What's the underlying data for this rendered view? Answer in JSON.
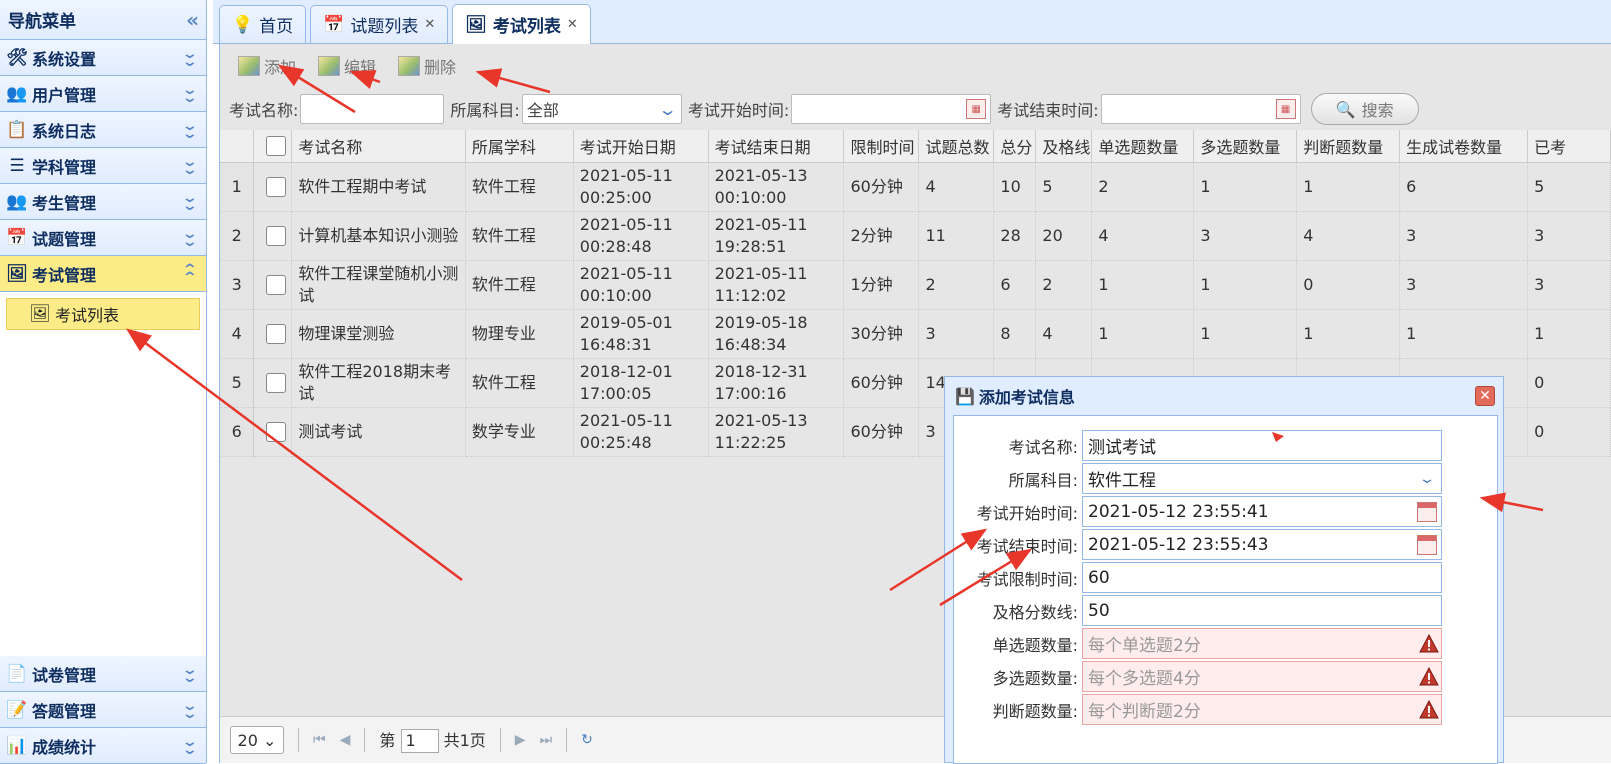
{
  "sidebar": {
    "title": "导航菜单",
    "groups_top": [
      {
        "label": "系统设置"
      },
      {
        "label": "用户管理"
      },
      {
        "label": "系统日志"
      },
      {
        "label": "学科管理"
      },
      {
        "label": "考生管理"
      },
      {
        "label": "试题管理"
      },
      {
        "label": "考试管理"
      }
    ],
    "active_sub": "考试列表",
    "groups_bottom": [
      {
        "label": "试卷管理"
      },
      {
        "label": "答题管理"
      },
      {
        "label": "成绩统计"
      }
    ]
  },
  "tabs": [
    {
      "label": "首页"
    },
    {
      "label": "试题列表"
    },
    {
      "label": "考试列表"
    }
  ],
  "toolbar": {
    "add": "添加",
    "edit": "编辑",
    "delete": "删除"
  },
  "filters": {
    "name_label": "考试名称:",
    "subject_label": "所属科目:",
    "subject_value": "全部",
    "start_label": "考试开始时间:",
    "end_label": "考试结束时间:",
    "search": "搜索"
  },
  "table": {
    "headers": [
      "考试名称",
      "所属学科",
      "考试开始日期",
      "考试结束日期",
      "限制时间",
      "试题总数",
      "总分",
      "及格线",
      "单选题数量",
      "多选题数量",
      "判断题数量",
      "生成试卷数量",
      "已考"
    ],
    "rows": [
      {
        "no": "1",
        "name": "软件工程期中考试",
        "subject": "软件工程",
        "start": "2021-05-11 00:25:00",
        "end": "2021-05-13 00:10:00",
        "limit": "60分钟",
        "total": "4",
        "score": "10",
        "pass": "5",
        "single": "2",
        "multi": "1",
        "judge": "1",
        "papers": "6",
        "taken": "5"
      },
      {
        "no": "2",
        "name": "计算机基本知识小测验",
        "subject": "软件工程",
        "start": "2021-05-11 00:28:48",
        "end": "2021-05-11 19:28:51",
        "limit": "2分钟",
        "total": "11",
        "score": "28",
        "pass": "20",
        "single": "4",
        "multi": "3",
        "judge": "4",
        "papers": "3",
        "taken": "3"
      },
      {
        "no": "3",
        "name": "软件工程课堂随机小测试",
        "subject": "软件工程",
        "start": "2021-05-11 00:10:00",
        "end": "2021-05-11 11:12:02",
        "limit": "1分钟",
        "total": "2",
        "score": "6",
        "pass": "2",
        "single": "1",
        "multi": "1",
        "judge": "0",
        "papers": "3",
        "taken": "3"
      },
      {
        "no": "4",
        "name": "物理课堂测验",
        "subject": "物理专业",
        "start": "2019-05-01 16:48:31",
        "end": "2019-05-18 16:48:34",
        "limit": "30分钟",
        "total": "3",
        "score": "8",
        "pass": "4",
        "single": "1",
        "multi": "1",
        "judge": "1",
        "papers": "1",
        "taken": "1"
      },
      {
        "no": "5",
        "name": "软件工程2018期末考试",
        "subject": "软件工程",
        "start": "2018-12-01 17:00:05",
        "end": "2018-12-31 17:00:16",
        "limit": "60分钟",
        "total": "14",
        "score": "",
        "pass": "",
        "single": "",
        "multi": "",
        "judge": "",
        "papers": "",
        "taken": "0"
      },
      {
        "no": "6",
        "name": "测试考试",
        "subject": "数学专业",
        "start": "2021-05-11 00:25:48",
        "end": "2021-05-13 11:22:25",
        "limit": "60分钟",
        "total": "3",
        "score": "",
        "pass": "",
        "single": "",
        "multi": "",
        "judge": "",
        "papers": "",
        "taken": "0"
      }
    ]
  },
  "pager": {
    "page_size": "20",
    "page_prefix": "第",
    "page": "1",
    "page_total": "共1页"
  },
  "dialog": {
    "title": "添加考试信息",
    "fields": [
      {
        "label": "考试名称:",
        "value": "测试考试",
        "kind": "text"
      },
      {
        "label": "所属科目:",
        "value": "软件工程",
        "kind": "select"
      },
      {
        "label": "考试开始时间:",
        "value": "2021-05-12 23:55:41",
        "kind": "date"
      },
      {
        "label": "考试结束时间:",
        "value": "2021-05-12 23:55:43",
        "kind": "date"
      },
      {
        "label": "考试限制时间:",
        "value": "60",
        "kind": "text"
      },
      {
        "label": "及格分数线:",
        "value": "50",
        "kind": "text"
      },
      {
        "label": "单选题数量:",
        "placeholder": "每个单选题2分",
        "kind": "invalid"
      },
      {
        "label": "多选题数量:",
        "placeholder": "每个多选题4分",
        "kind": "invalid"
      },
      {
        "label": "判断题数量:",
        "placeholder": "每个判断题2分",
        "kind": "invalid"
      }
    ]
  },
  "colors": {
    "accent": "#95b8e7",
    "active_menu": "#fbec88",
    "annotation": "#e8362b"
  }
}
